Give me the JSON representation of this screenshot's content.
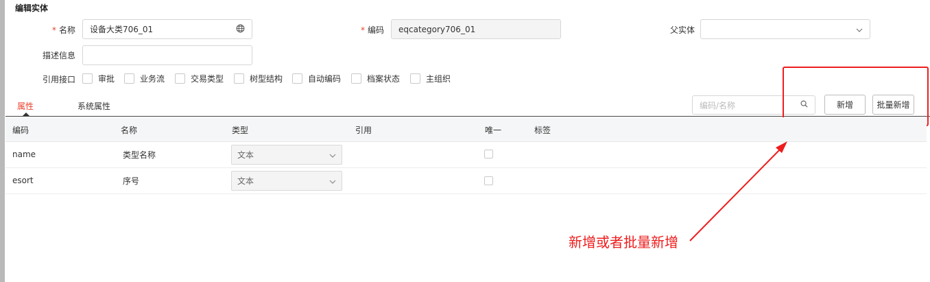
{
  "section": {
    "title": "编辑实体"
  },
  "form": {
    "name_label": "名称",
    "name_value": "设备大类706_01",
    "code_label": "编码",
    "code_value": "eqcategory706_01",
    "parent_label": "父实体",
    "parent_value": "",
    "desc_label": "描述信息",
    "desc_value": "",
    "interfaces_label": "引用接口",
    "required_mark": "*",
    "interfaces": [
      {
        "label": "审批"
      },
      {
        "label": "业务流"
      },
      {
        "label": "交易类型"
      },
      {
        "label": "树型结构"
      },
      {
        "label": "自动编码"
      },
      {
        "label": "档案状态"
      },
      {
        "label": "主组织"
      }
    ]
  },
  "tabs": [
    {
      "label": "属性",
      "active": true
    },
    {
      "label": "系统属性",
      "active": false
    }
  ],
  "toolbar": {
    "search_placeholder": "编码/名称",
    "add_label": "新增",
    "batch_add_label": "批量新增"
  },
  "table": {
    "headers": [
      "编码",
      "名称",
      "类型",
      "引用",
      "唯一",
      "标签"
    ],
    "rows": [
      {
        "code": "name",
        "name": "类型名称",
        "type": "文本",
        "ref": "",
        "unique": false,
        "tag": ""
      },
      {
        "code": "esort",
        "name": "序号",
        "type": "文本",
        "ref": "",
        "unique": false,
        "tag": ""
      }
    ]
  },
  "annotation": {
    "text": "新增或者批量新增",
    "color": "#ee1c1c"
  },
  "colors": {
    "accent": "#e8412c",
    "annotation_red": "#ee1c1c"
  }
}
